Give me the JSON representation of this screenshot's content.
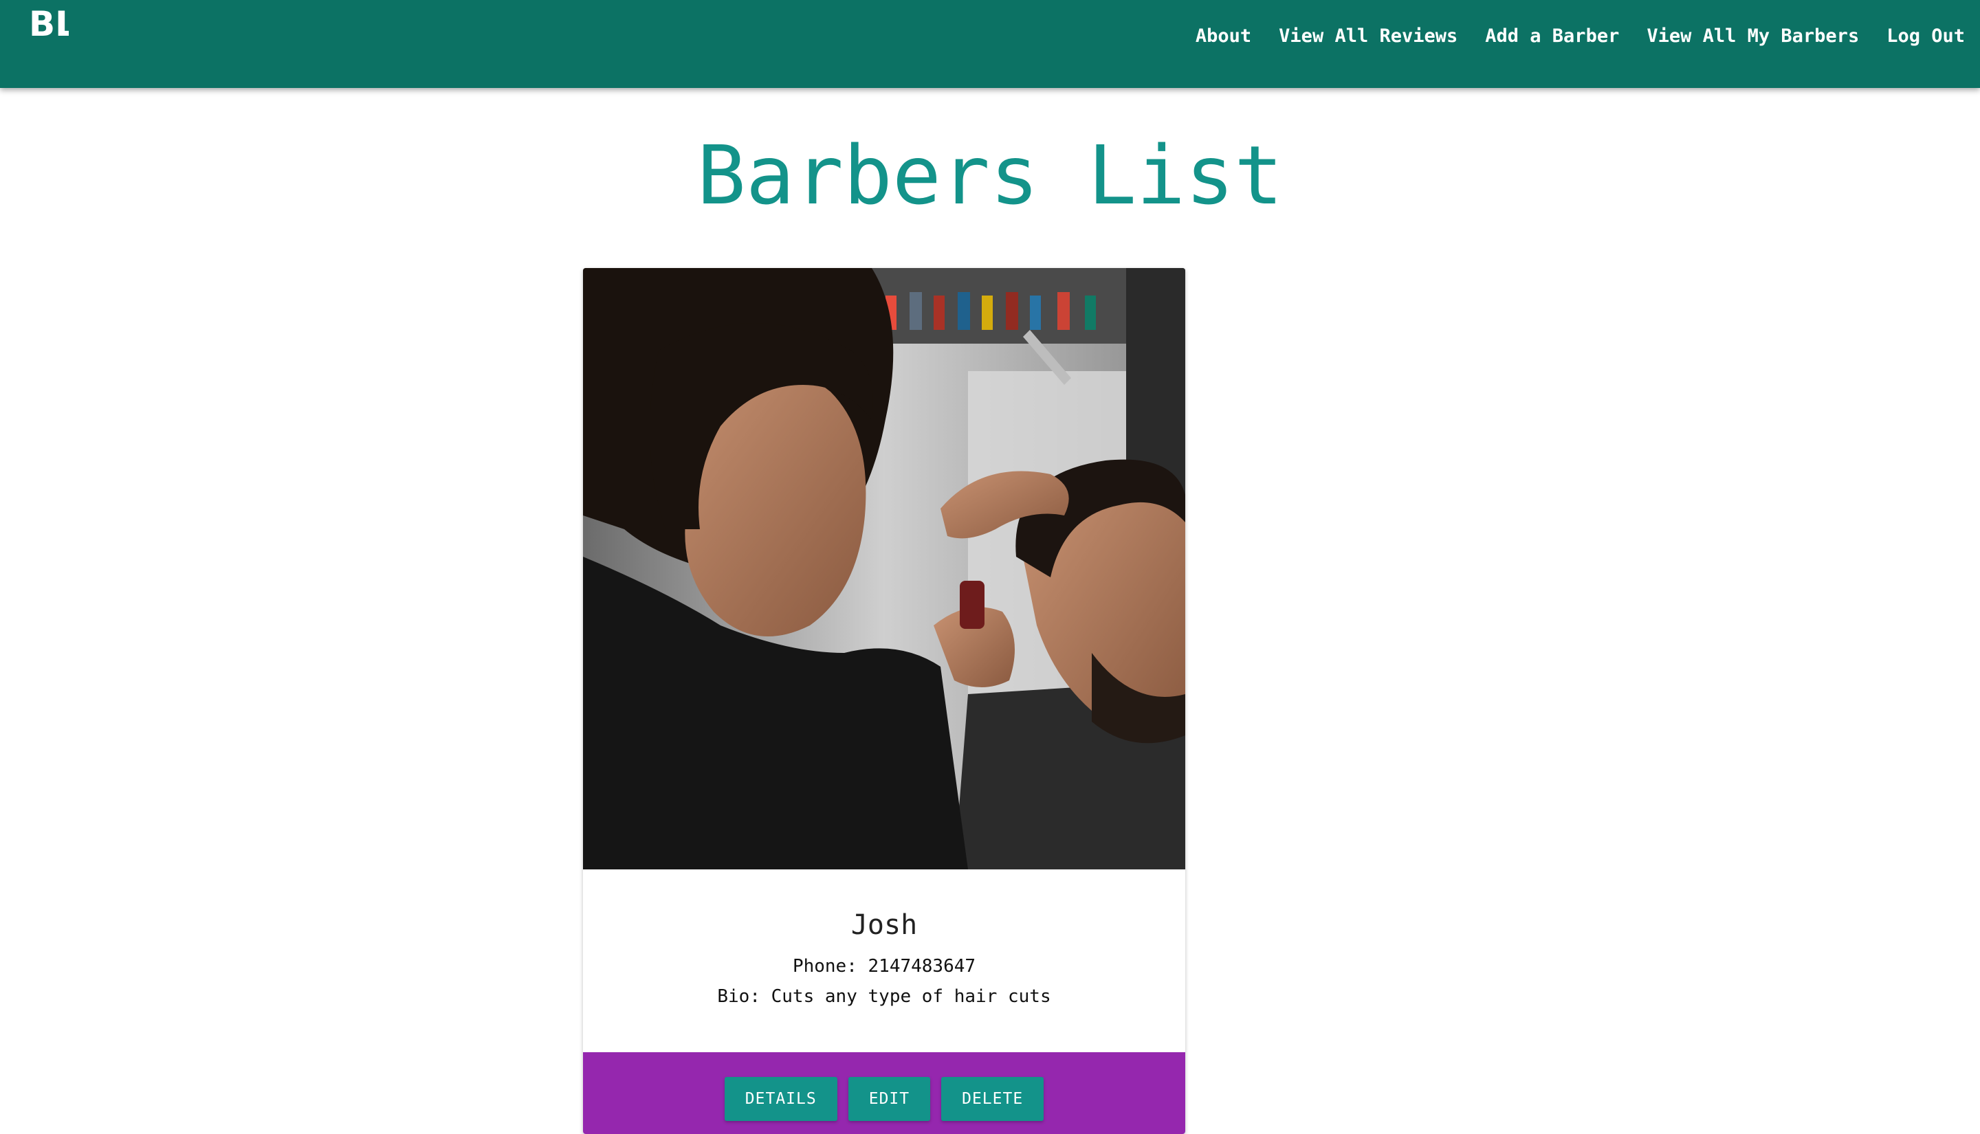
{
  "app": {
    "logo_text": "BL"
  },
  "nav": {
    "items": [
      {
        "label": "About"
      },
      {
        "label": "View All Reviews"
      },
      {
        "label": "Add a Barber"
      },
      {
        "label": "View All My Barbers"
      },
      {
        "label": "Log Out"
      }
    ]
  },
  "main": {
    "title": "Barbers List",
    "cards": [
      {
        "name": "Josh",
        "phone": "Phone: 2147483647",
        "bio": "Bio: Cuts any type of hair cuts",
        "actions": {
          "details": "DETAILS",
          "edit": "EDIT",
          "delete": "DELETE"
        }
      }
    ]
  },
  "colors": {
    "navbar": "#0c7264",
    "accent": "#13938a",
    "card_footer": "#9527ae"
  }
}
